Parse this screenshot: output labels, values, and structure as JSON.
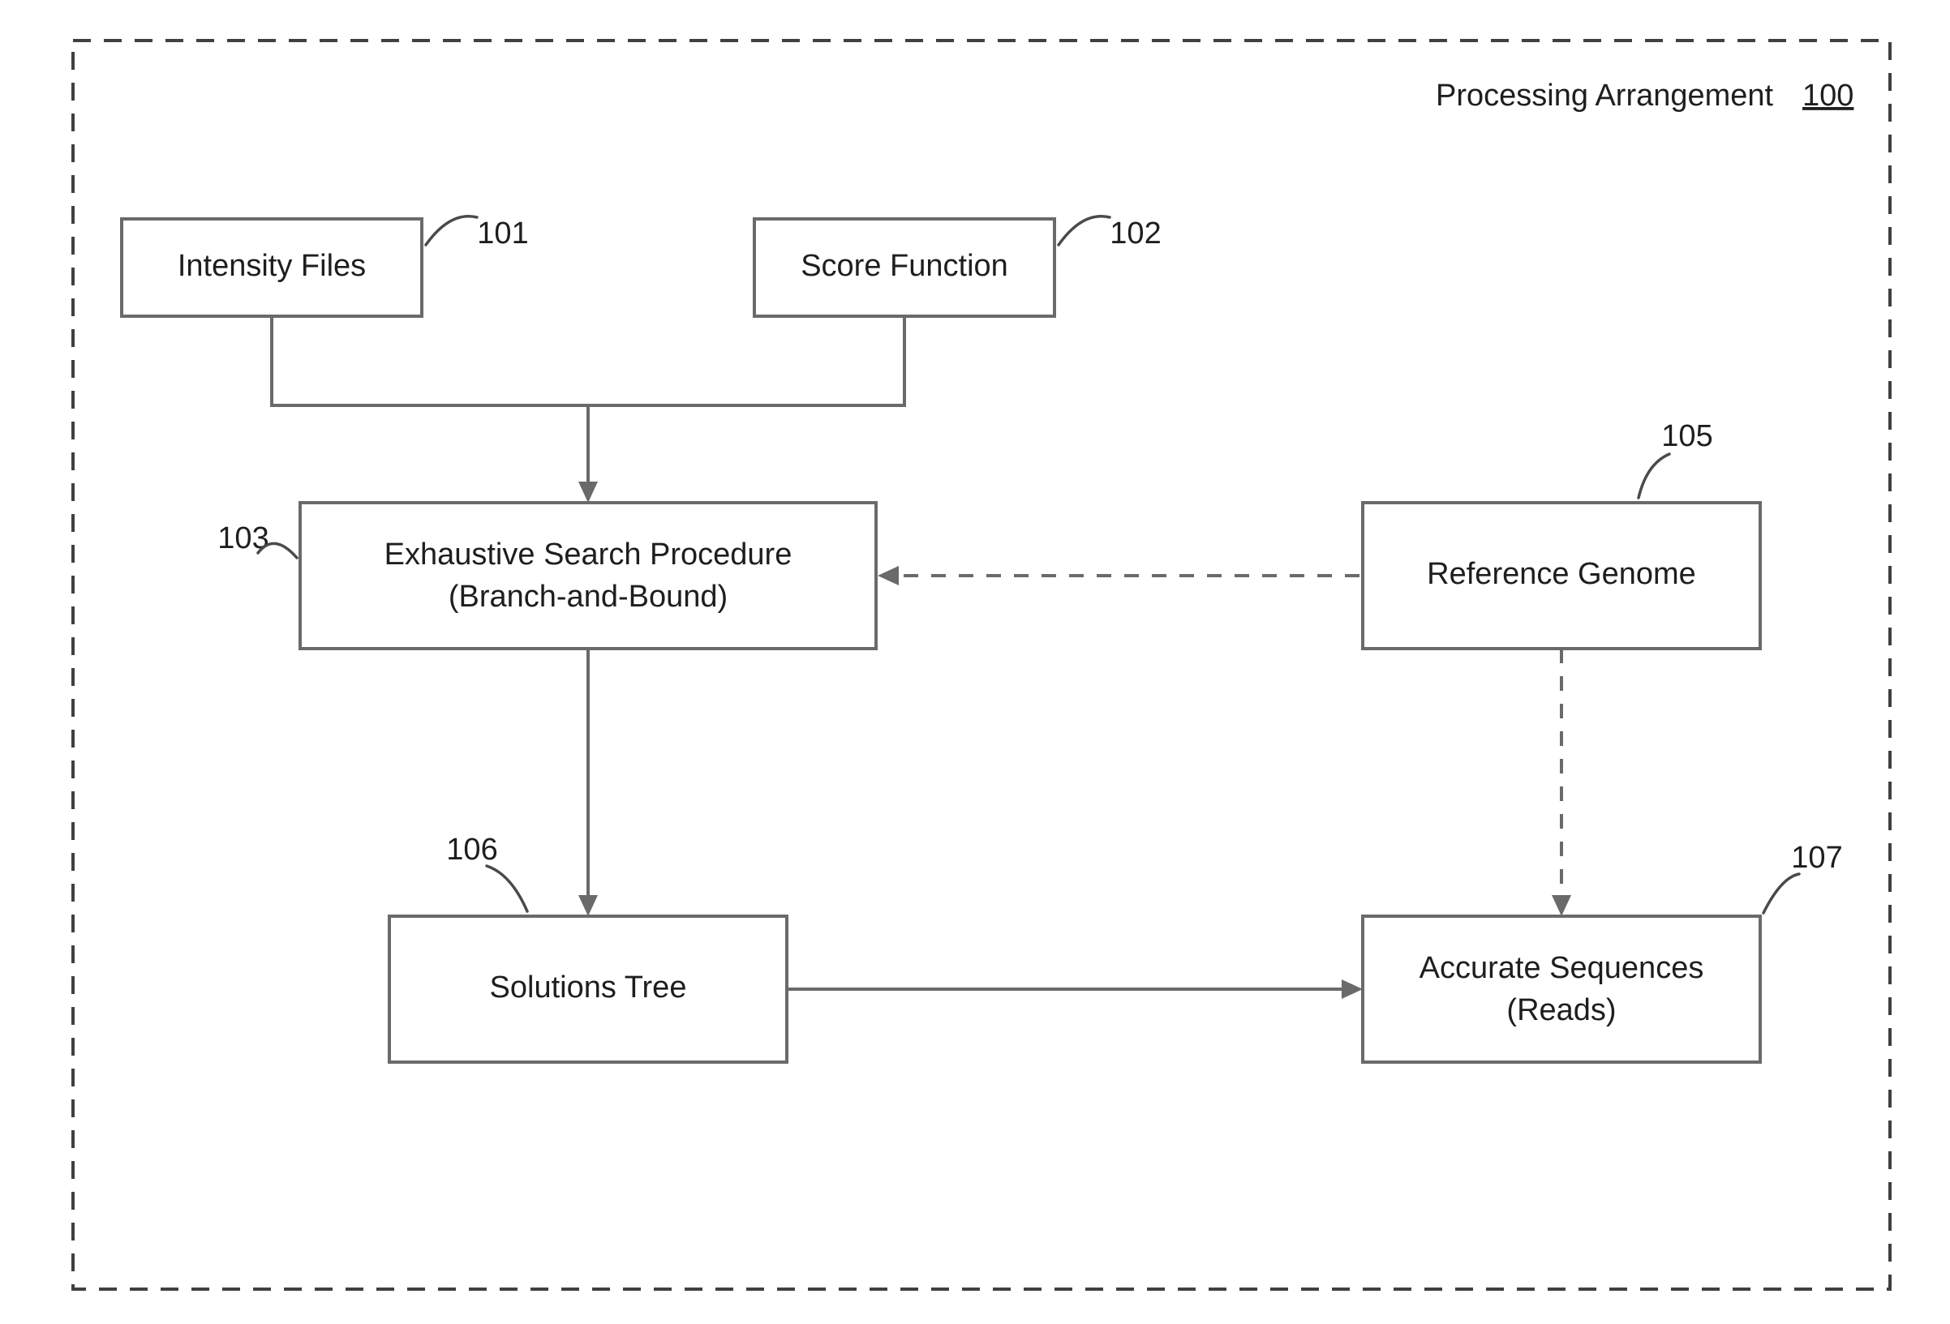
{
  "title": {
    "text": "Processing Arrangement",
    "num": "100"
  },
  "boxes": {
    "intensity": {
      "label": "Intensity Files",
      "ref": "101"
    },
    "score": {
      "label": "Score Function",
      "ref": "102"
    },
    "search": {
      "line1": "Exhaustive Search Procedure",
      "line2": "(Branch-and-Bound)",
      "ref": "103"
    },
    "genome": {
      "label": "Reference Genome",
      "ref": "105"
    },
    "tree": {
      "label": "Solutions Tree",
      "ref": "106"
    },
    "reads": {
      "line1": "Accurate Sequences",
      "line2": "(Reads)",
      "ref": "107"
    }
  }
}
